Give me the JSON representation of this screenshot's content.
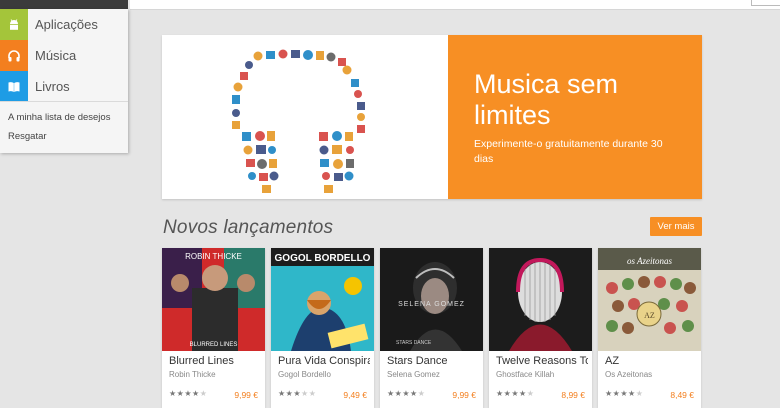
{
  "sidebar": {
    "items": [
      {
        "label": "Aplicações",
        "icon": "android-icon",
        "color": "#a4c53a"
      },
      {
        "label": "Música",
        "icon": "headphones-icon",
        "color": "#f37f1f"
      },
      {
        "label": "Livros",
        "icon": "book-icon",
        "color": "#1e9ce5"
      }
    ],
    "links": [
      "A minha lista de desejos",
      "Resgatar"
    ]
  },
  "banner": {
    "title": "Musica sem limites",
    "subtitle": "Experimente-o gratuitamente durante 30 dias",
    "accent": "#f78f24"
  },
  "section": {
    "title": "Novos lançamentos",
    "see_more": "Ver mais"
  },
  "albums": [
    {
      "title": "Blurred Lines",
      "artist": "Robin Thicke",
      "price": "9,99 €",
      "rating": 4,
      "cover_text": "ROBIN THICKE",
      "cover_text2": "BLURRED LINES"
    },
    {
      "title": "Pura Vida Conspira",
      "artist": "Gogol Bordello",
      "price": "9,49 €",
      "rating": 3.5,
      "cover_text": "GOGOL BORDELLO"
    },
    {
      "title": "Stars Dance",
      "artist": "Selena Gomez",
      "price": "9,99 €",
      "rating": 4,
      "cover_text": "SELENA GOMEZ",
      "cover_text2": "STARS DANCE"
    },
    {
      "title": "Twelve Reasons To",
      "artist": "Ghostface Killah",
      "price": "8,99 €",
      "rating": 4
    },
    {
      "title": "AZ",
      "artist": "Os Azeitonas",
      "price": "8,49 €",
      "rating": 4,
      "cover_text": "os Azeitonas",
      "cover_text2": "AZ"
    }
  ]
}
